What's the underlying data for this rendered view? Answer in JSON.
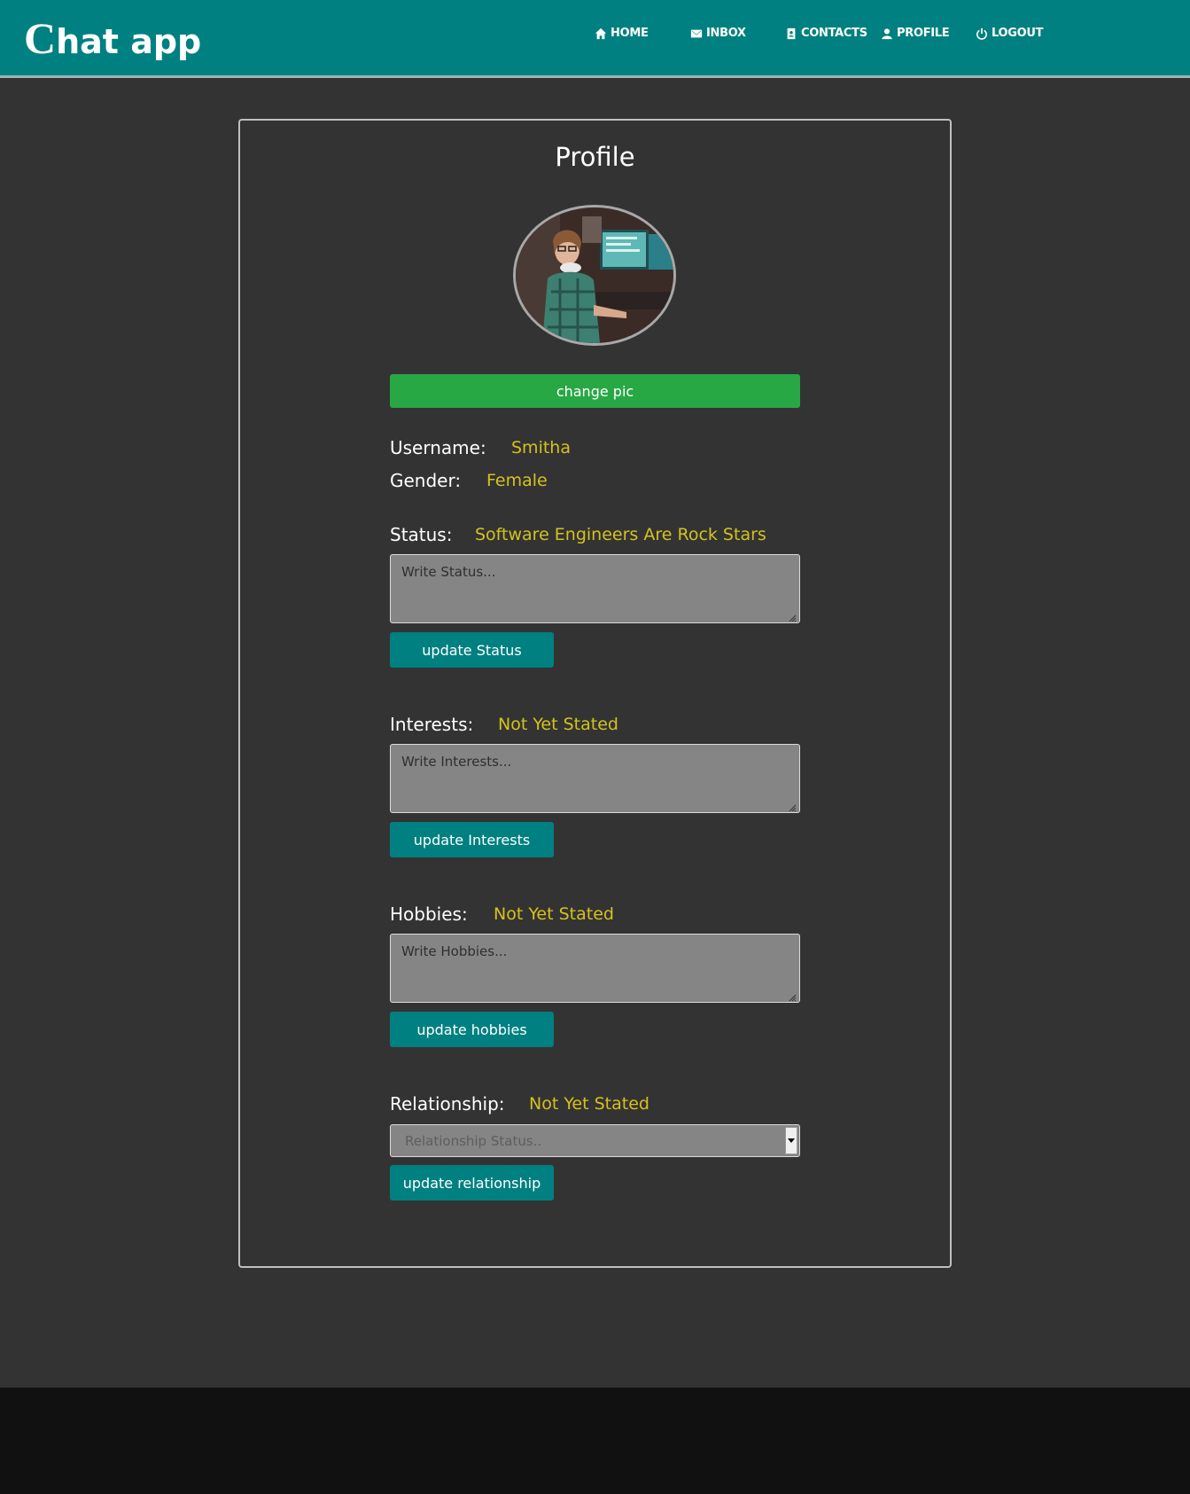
{
  "navbar": {
    "brand_initial": "C",
    "brand_rest": "hat app",
    "items": [
      {
        "label": "HOME",
        "icon": "home-icon"
      },
      {
        "label": "INBOX",
        "icon": "envelope-icon"
      },
      {
        "label": "CONTACTS",
        "icon": "contacts-icon"
      },
      {
        "label": "PROFILE",
        "icon": "user-icon"
      },
      {
        "label": "LOGOUT",
        "icon": "power-icon"
      }
    ]
  },
  "profile": {
    "title": "Profile",
    "change_pic_label": "change pic",
    "username_label": "Username:",
    "username_value": "Smitha",
    "gender_label": "Gender:",
    "gender_value": "Female",
    "status": {
      "label": "Status:",
      "value": "Software Engineers Are Rock Stars",
      "placeholder": "Write Status...",
      "button": "update Status"
    },
    "interests": {
      "label": "Interests:",
      "value": "Not Yet Stated",
      "placeholder": "Write Interests...",
      "button": "update Interests"
    },
    "hobbies": {
      "label": "Hobbies:",
      "value": "Not Yet Stated",
      "placeholder": "Write Hobbies...",
      "button": "update hobbies"
    },
    "relationship": {
      "label": "Relationship:",
      "value": "Not Yet Stated",
      "select_placeholder": "Relationship Status..",
      "button": "update relationship"
    }
  },
  "colors": {
    "navbar": "#008080",
    "background": "#333333",
    "footer": "#111111",
    "accent_value": "#d4c21f",
    "green_button": "#28a745",
    "teal_button": "#008080"
  }
}
